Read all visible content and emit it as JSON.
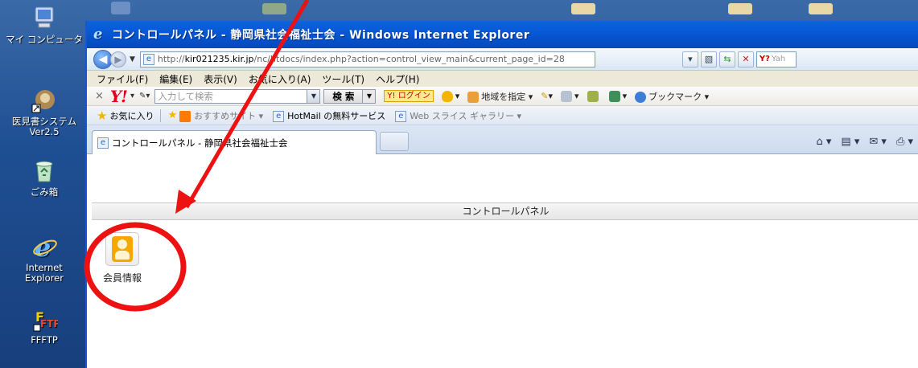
{
  "desktop": {
    "icons": [
      {
        "label": "マイ コンピュータ",
        "icon": "my-computer-icon"
      },
      {
        "label": "医見書システム\nVer2.5",
        "icon": "app-shortcut-icon"
      },
      {
        "label": "ごみ箱",
        "icon": "recycle-bin-icon"
      },
      {
        "label": "Internet\nExplorer",
        "icon": "internet-explorer-icon"
      },
      {
        "label": "FFFTP",
        "icon": "ffftp-icon"
      }
    ]
  },
  "browser": {
    "title": "コントロールパネル - 静岡県社会福祉士会 - Windows Internet Explorer",
    "url_prefix": "http://",
    "url_host": "kir021235.kir.jp",
    "url_path": "/nc/htdocs/index.php?action=control_view_main&current_page_id=28",
    "search_provider": "Yah",
    "menu": [
      "ファイル(F)",
      "編集(E)",
      "表示(V)",
      "お気に入り(A)",
      "ツール(T)",
      "ヘルプ(H)"
    ],
    "yahoo_toolbar": {
      "logo": "Y!",
      "search_placeholder": "入力して検索",
      "search_button": "検 索",
      "login_button": "Y! ログイン",
      "region_label": "地域を指定",
      "bookmark_label": "ブックマーク"
    },
    "favorites_bar": {
      "favorites_label": "お気に入り",
      "items": [
        {
          "label": "おすすめサイト ▾",
          "dim": true
        },
        {
          "label": "HotMail の無料サービス",
          "dim": false
        },
        {
          "label": "Web スライス ギャラリー ▾",
          "dim": true
        }
      ]
    },
    "tab": {
      "label": "コントロールパネル - 静岡県社会福祉士会"
    }
  },
  "page": {
    "header": "コントロールパネル",
    "member_button": {
      "label": "会員情報",
      "icon": "member-person-icon"
    }
  },
  "annotations": {
    "arrow_color": "#ee1111",
    "circle_color": "#ee1111"
  }
}
